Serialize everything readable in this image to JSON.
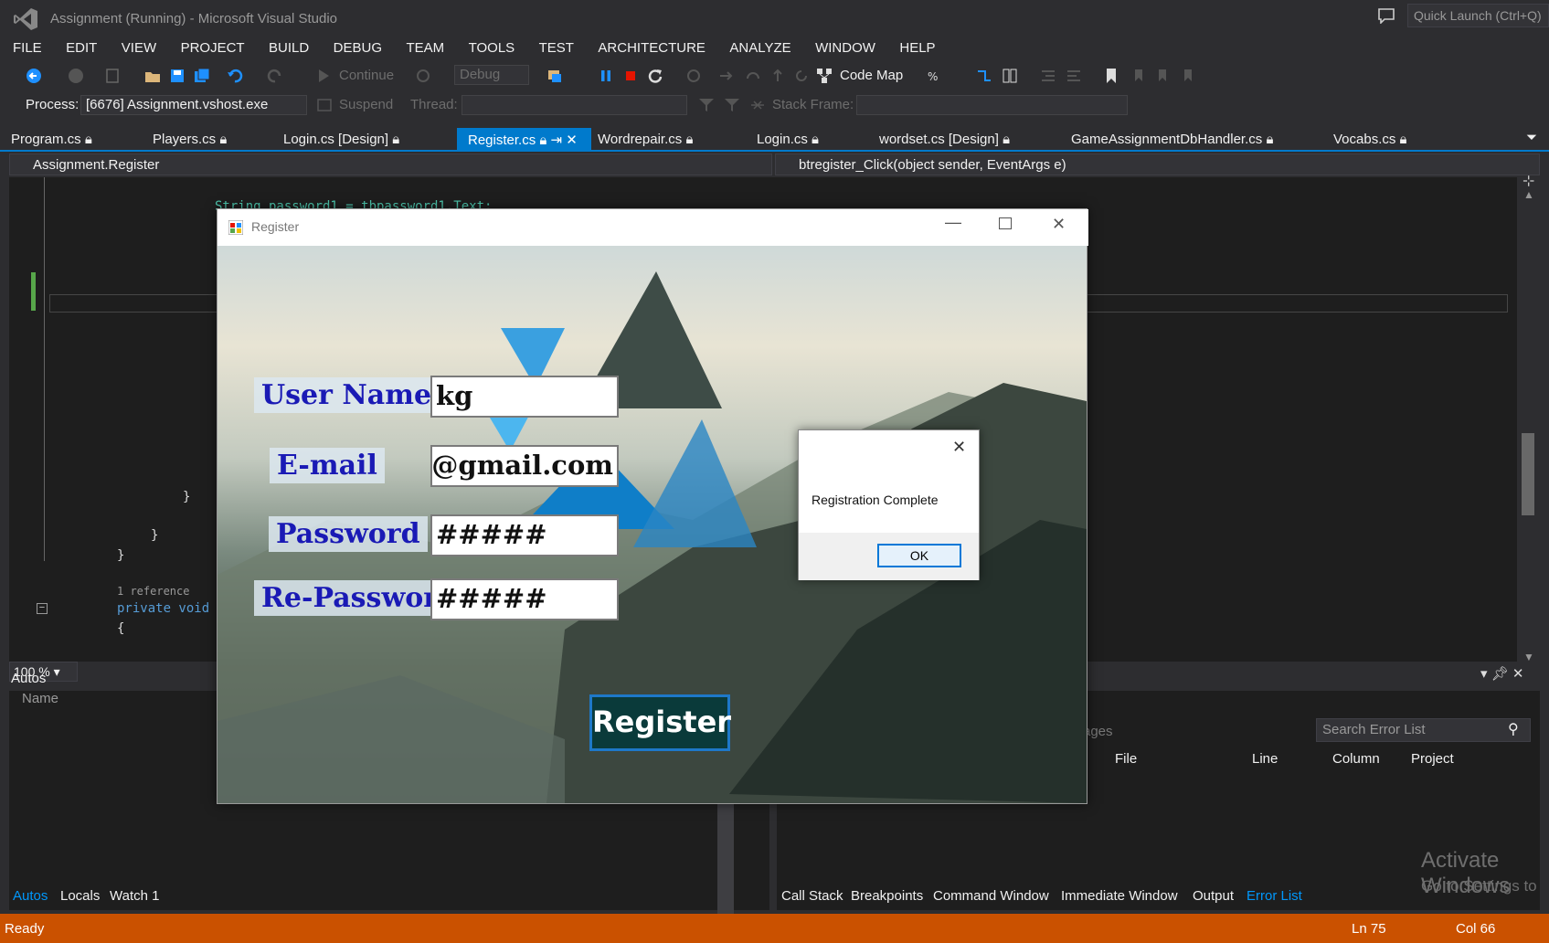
{
  "window": {
    "title": "Assignment (Running) - Microsoft Visual Studio",
    "quick_launch": "Quick Launch (Ctrl+Q)"
  },
  "menu": [
    "FILE",
    "EDIT",
    "VIEW",
    "PROJECT",
    "BUILD",
    "DEBUG",
    "TEAM",
    "TOOLS",
    "TEST",
    "ARCHITECTURE",
    "ANALYZE",
    "WINDOW",
    "HELP"
  ],
  "toolbar": {
    "continue_label": "Continue",
    "config": "Debug",
    "code_map": "Code Map"
  },
  "toolbar2": {
    "process_label": "Process:",
    "process_value": "[6676] Assignment.vshost.exe",
    "suspend": "Suspend",
    "thread_label": "Thread:",
    "stack_frame_label": "Stack Frame:"
  },
  "tabs": [
    "Program.cs",
    "Players.cs",
    "Login.cs [Design]",
    "Register.cs",
    "Wordrepair.cs",
    "Login.cs",
    "wordset.cs [Design]",
    "GameAssignmentDbHandler.cs",
    "Vocabs.cs"
  ],
  "nav": {
    "left": "Assignment.Register",
    "right": "btregister_Click(object sender, EventArgs e)"
  },
  "code": {
    "line1": "String password1 = tbpassword1.Text;",
    "brace1": "}",
    "brace2": "}",
    "brace3": "}",
    "ref": "1 reference",
    "private": "private void",
    "brace4": "{"
  },
  "zoom": "100 %",
  "autos": {
    "title": "Autos",
    "name_col": "Name"
  },
  "errors": {
    "messages_partial": "ssages",
    "search": "Search Error List",
    "cols": [
      "File",
      "Line",
      "Column",
      "Project"
    ]
  },
  "bottom_tabs_left": [
    "Autos",
    "Locals",
    "Watch 1"
  ],
  "bottom_tabs_right": [
    "Call Stack",
    "Breakpoints",
    "Command Window",
    "Immediate Window",
    "Output",
    "Error List"
  ],
  "status": {
    "ready": "Ready",
    "ln": "Ln 75",
    "col": "Col 66"
  },
  "activate": {
    "line1": "Activate Windows",
    "line2": "Go to Settings to"
  },
  "register_form": {
    "title": "Register",
    "user_label": "User Name",
    "user_value": "kg",
    "email_label": "E-mail",
    "email_value": "kg@gmail.com",
    "pw_label": "Password",
    "pw_value": "#####",
    "repw_label": "Re-Password",
    "repw_value": "#####",
    "button": "Register"
  },
  "message_box": {
    "text": "Registration Complete",
    "ok": "OK"
  }
}
